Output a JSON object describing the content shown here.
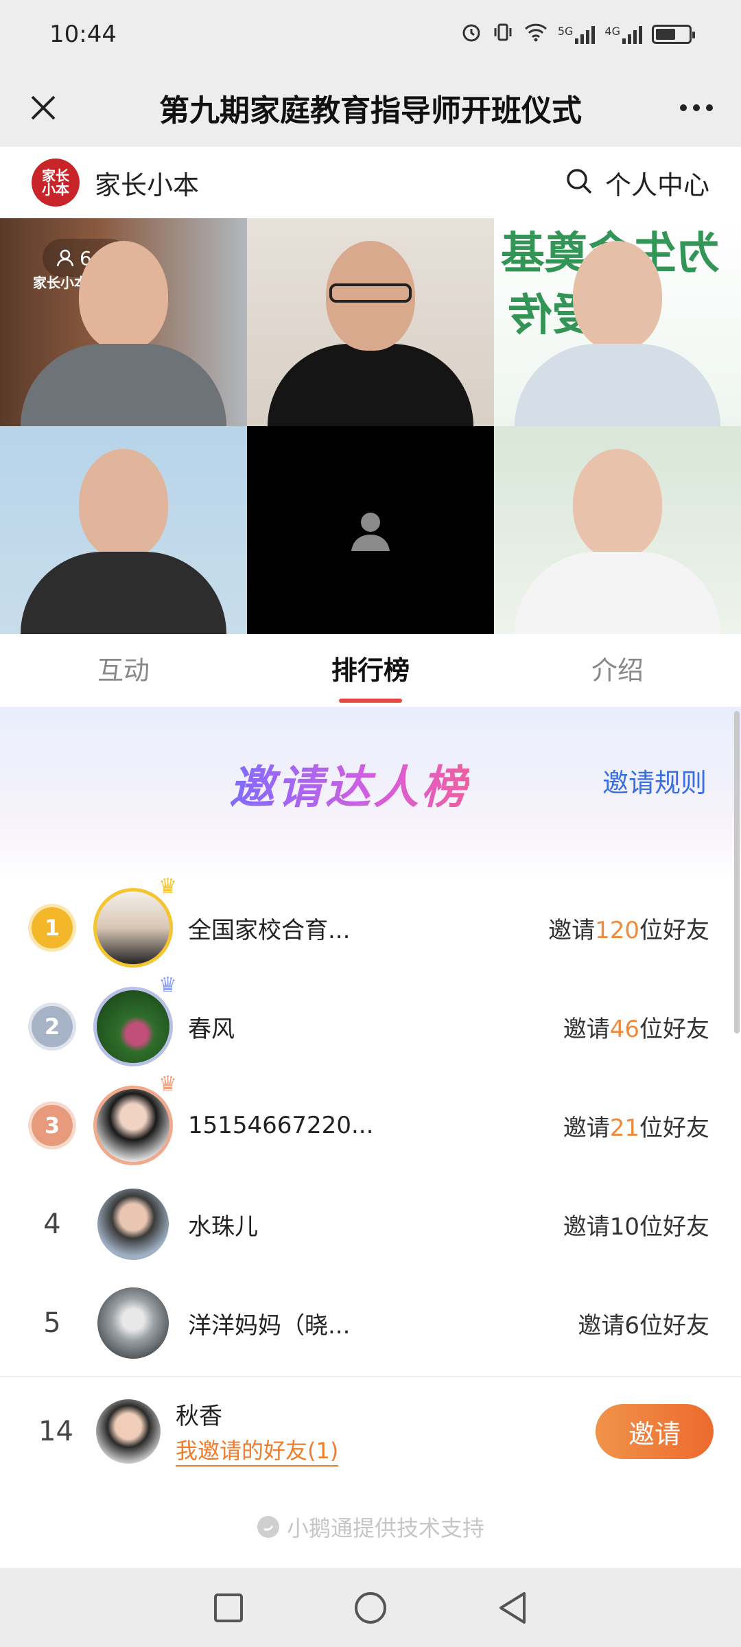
{
  "status_bar": {
    "time": "10:44",
    "signal_labels": [
      "5G",
      "4G"
    ],
    "battery_level": 0.6
  },
  "title_bar": {
    "title": "第九期家庭教育指导师开班仪式"
  },
  "app_header": {
    "brand_logo_text": "家长\n小本",
    "brand_name": "家长小本",
    "user_center": "个人中心"
  },
  "video": {
    "viewer_count": "642",
    "watermark": "家长小本",
    "bg_text_1": "为生命奠基",
    "bg_text_2": "爱传"
  },
  "tabs": [
    {
      "label": "互动",
      "active": false
    },
    {
      "label": "排行榜",
      "active": true
    },
    {
      "label": "介绍",
      "active": false
    }
  ],
  "leaderboard": {
    "title": "邀请达人榜",
    "rules_label": "邀请规则",
    "rows": [
      {
        "rank": "1",
        "name": "全国家校合育...",
        "prefix": "邀请",
        "count": "120",
        "suffix": "位好友",
        "badge_color": "#f5b72a",
        "crown_color": "#f5c431",
        "ring": "#f5c431"
      },
      {
        "rank": "2",
        "name": "春风",
        "prefix": "邀请",
        "count": "46",
        "suffix": "位好友",
        "badge_color": "#a7b3c6",
        "crown_color": "#8fa1ee",
        "ring": "#b8c0e8"
      },
      {
        "rank": "3",
        "name": "15154667220...",
        "prefix": "邀请",
        "count": "21",
        "suffix": "位好友",
        "badge_color": "#e79a7c",
        "crown_color": "#f0a07e",
        "ring": "#f0a98c"
      },
      {
        "rank": "4",
        "name": "水珠儿",
        "text": "邀请10位好友"
      },
      {
        "rank": "5",
        "name": "洋洋妈妈（晓...",
        "text": "邀请6位好友"
      }
    ]
  },
  "my_entry": {
    "rank": "14",
    "name": "秋香",
    "invited_link": "我邀请的好友(1)",
    "invite_button": "邀请"
  },
  "footer": {
    "powered_by": "小鹅通提供技术支持"
  },
  "colors": {
    "accent": "#e5473f",
    "orange": "#ef7d2c",
    "link_blue": "#3a6fe0"
  }
}
